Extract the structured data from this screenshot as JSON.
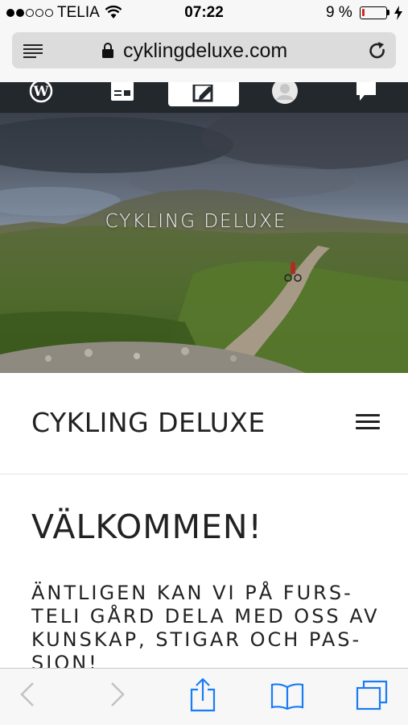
{
  "status_bar": {
    "carrier": "TELIA",
    "time": "07:22",
    "battery_percent": "9 %"
  },
  "browser": {
    "url": "cyklingdeluxe.com"
  },
  "admin_bar": {
    "items": [
      "wordpress-icon",
      "reader-icon",
      "edit-icon",
      "profile-icon",
      "notifications-icon"
    ],
    "active_index": 2
  },
  "hero": {
    "title": "CYKLING  DELUXE"
  },
  "site": {
    "title": "CYKLING DELUXE"
  },
  "content": {
    "heading": "VÄLKOMMEN!",
    "lead": "ÄNTLIGEN KAN VI PÅ FURS- TELI GÅRD DELA MED OSS AV KUNSKAP, STIGAR OCH PAS- SION!"
  },
  "colors": {
    "admin_bar": "#23282d",
    "ios_blue": "#1a7cf5",
    "battery_low": "#e02020"
  }
}
